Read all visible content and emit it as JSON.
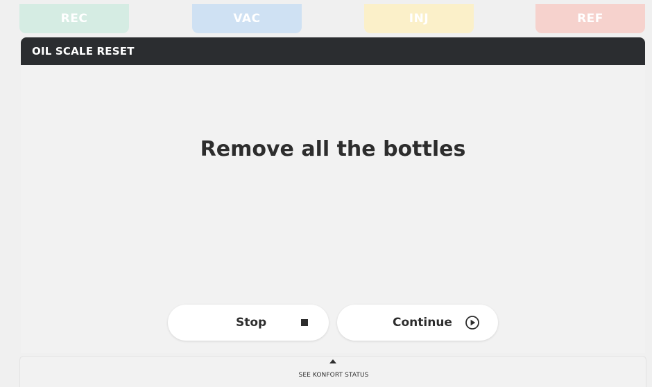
{
  "tabs": [
    {
      "label": "REC",
      "color": "#d5ece3"
    },
    {
      "label": "VAC",
      "color": "#cfe1f3"
    },
    {
      "label": "INJ",
      "color": "#fbf0c9"
    },
    {
      "label": "REF",
      "color": "#f6d2cd"
    }
  ],
  "panel": {
    "title": "OIL SCALE RESET",
    "message": "Remove all the bottles"
  },
  "actions": {
    "stop_label": "Stop",
    "stop_icon": "stop-square-icon",
    "continue_label": "Continue",
    "continue_icon": "play-circle-icon"
  },
  "status_bar": {
    "label": "SEE KONFORT STATUS",
    "icon": "caret-up-icon"
  },
  "colors": {
    "header_bg": "#2b2d30",
    "page_bg": "#f0f0f0"
  }
}
